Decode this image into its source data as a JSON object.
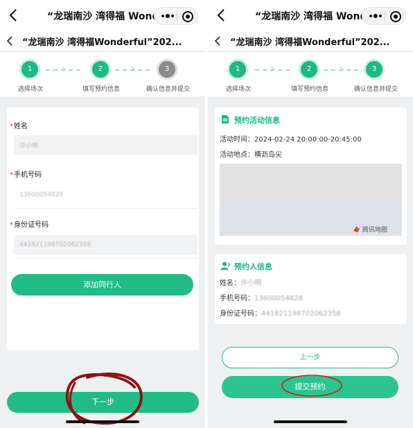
{
  "statusbar": {
    "title": "“龙瑞南沙 湾得福 Wonde..."
  },
  "left": {
    "nav_title": "“龙瑞南沙 湾得福Wonderful”202...",
    "steps": [
      {
        "number": "1",
        "label": "选择场次"
      },
      {
        "number": "2",
        "label": "填写预约信息"
      },
      {
        "number": "3",
        "label": "确认信息并提交"
      }
    ],
    "form": {
      "name_label": "姓名",
      "name_value": "许小明",
      "phone_label": "手机号码",
      "phone_value": "13600054828",
      "id_label": "身份证号码",
      "id_value": "441821198702062358",
      "required_mark": "*"
    },
    "add_companion_label": "添加同行人",
    "next_label": "下一步"
  },
  "right": {
    "nav_title": "“龙瑞南沙 湾得福Wonderful”202...",
    "steps": [
      {
        "number": "1",
        "label": "选择场次"
      },
      {
        "number": "2",
        "label": "填写预约信息"
      },
      {
        "number": "3",
        "label": "确认信息并提交"
      }
    ],
    "activity": {
      "heading": "预约活动信息",
      "time_label": "活动时间：",
      "time_value": "2024-02-24 20:00:00-20:45:00",
      "place_label": "活动地点：",
      "place_value": "横沥岛尖",
      "map_logo": "腾讯地图"
    },
    "person": {
      "heading": "预约人信息",
      "name_label": "姓名：",
      "name_value": "许小明",
      "phone_label": "手机号码：",
      "phone_value": "13600054828",
      "id_label": "身份证号码：",
      "id_value": "441821198702062358"
    },
    "prev_label": "上一步",
    "submit_label": "提交预约"
  },
  "colors": {
    "accent": "#22bb86",
    "annotation": "#b01818",
    "required": "#e0403a"
  }
}
